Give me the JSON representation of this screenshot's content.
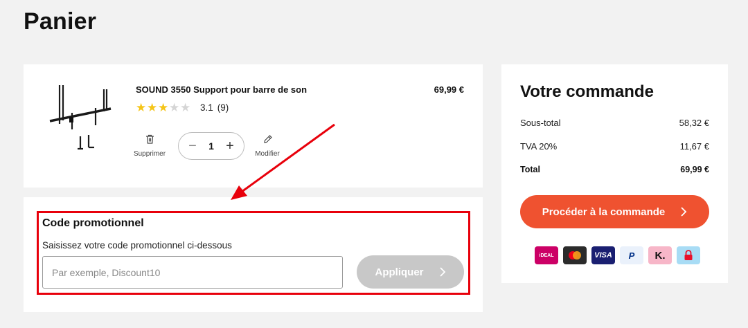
{
  "page": {
    "title": "Panier"
  },
  "cart": {
    "item": {
      "name": "SOUND 3550 Support pour barre de son",
      "price": "69,99 €",
      "rating": {
        "value": "3.1",
        "count": "(9)",
        "stars_filled": 3,
        "stars_total": 5
      },
      "quantity": "1",
      "delete_label": "Supprimer",
      "edit_label": "Modifier"
    }
  },
  "promo": {
    "title": "Code promotionnel",
    "subtitle": "Saisissez votre code promotionnel ci-dessous",
    "placeholder": "Par exemple, Discount10",
    "apply_label": "Appliquer"
  },
  "order": {
    "title": "Votre commande",
    "rows": [
      {
        "label": "Sous-total",
        "value": "58,32 €"
      },
      {
        "label": "TVA 20%",
        "value": "11,67 €"
      },
      {
        "label": "Total",
        "value": "69,99 €"
      }
    ],
    "checkout_label": "Procéder à la commande",
    "payment_methods": [
      "ideal-icon",
      "mastercard-icon",
      "visa-icon",
      "paypal-icon",
      "klarna-icon",
      "secure-lock-icon"
    ],
    "payment_labels": {
      "ideal": "iDEAL",
      "visa": "VISA",
      "paypal": "P",
      "klarna": "K."
    }
  },
  "colors": {
    "accent": "#ef5230",
    "highlight": "#e8000b",
    "star": "#f5c518",
    "apply_disabled": "#c8c8c8"
  }
}
